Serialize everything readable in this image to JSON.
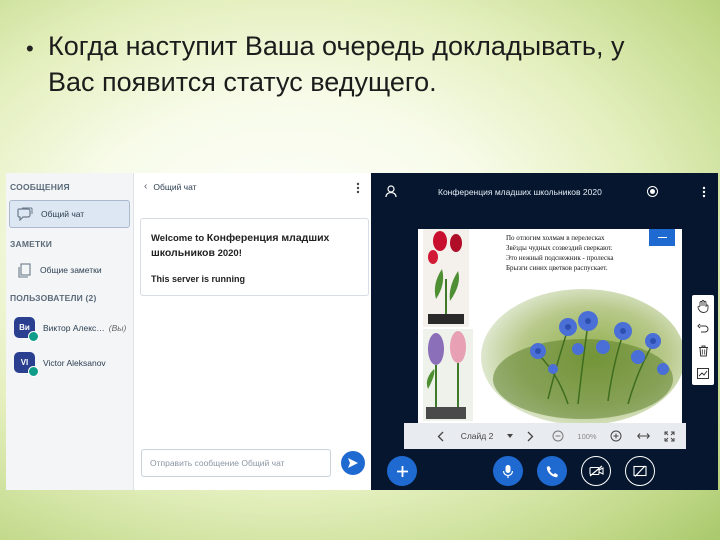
{
  "bullet": {
    "text": "Когда наступит Ваша очередь докладывать, у Вас появится статус ведущего."
  },
  "userlist": {
    "messages_heading": "СООБЩЕНИЯ",
    "public_chat_label": "Общий чат",
    "notes_heading": "ЗАМЕТКИ",
    "shared_notes_label": "Общие заметки",
    "users_heading": "ПОЛЬЗОВАТЕЛИ (2)",
    "users": [
      {
        "initials": "Ви",
        "name": "Виктор Алекс…",
        "suffix": "(Вы)"
      },
      {
        "initials": "VI",
        "name": "Victor Aleksanov",
        "suffix": ""
      }
    ]
  },
  "chat": {
    "title": "Общий чат",
    "welcome_prefix": "Welcome to ",
    "welcome_conf": "Конференция младших школьников",
    "welcome_year": " 2020!",
    "server_status": "This server is running",
    "input_placeholder": "Отправить сообщение Общий чат"
  },
  "presentation": {
    "title": "Конференция младших школьников 2020",
    "poem": [
      "По отлогим холмам в перелесках",
      "Звёзды чудных созвездий сверкают.",
      "Это  нежный подснежник - пролеска",
      "Брызги синих цветков распускает."
    ],
    "slide_label": "Слайд 2",
    "zoom": "100%"
  },
  "colors": {
    "accent_blue": "#1f6ad1",
    "presentation_bg": "#05162e",
    "avatar_bg": "#2a3f8f",
    "status_green": "#0f9d8a"
  },
  "icons": [
    "chat-bubble-icon",
    "notes-icon",
    "back-chevron-icon",
    "kebab-icon",
    "send-icon",
    "user-icon",
    "record-icon",
    "minimize-icon",
    "hand-icon",
    "undo-icon",
    "trash-icon",
    "chart-icon",
    "prev-slide-icon",
    "next-slide-icon",
    "zoom-out-icon",
    "zoom-in-icon",
    "fit-width-icon",
    "fullscreen-icon",
    "plus-icon",
    "microphone-icon",
    "phone-icon",
    "video-off-icon",
    "screen-share-icon"
  ]
}
